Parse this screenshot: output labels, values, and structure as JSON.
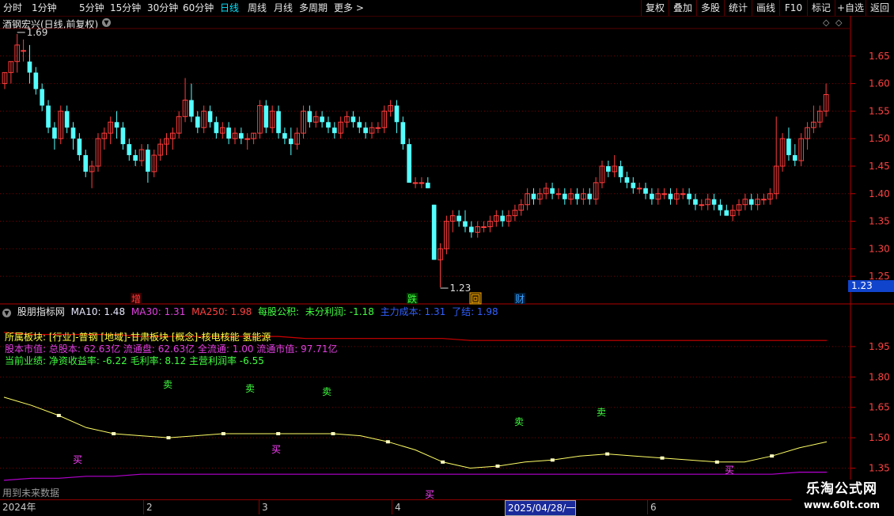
{
  "toolbar": {
    "periods": [
      "分时",
      "1分钟",
      "5分钟",
      "15分钟",
      "30分钟",
      "60分钟",
      "日线",
      "周线",
      "月线",
      "多周期",
      "更多 >"
    ],
    "active_period": "日线",
    "right_buttons": [
      "复权",
      "叠加",
      "多股",
      "统计",
      "画线",
      "F10",
      "标记",
      "+自选",
      "返回"
    ]
  },
  "stock_title": "酒钢宏兴(日线,前复权)",
  "diamond_icon": "◇",
  "price_axis": [
    "1.65",
    "1.60",
    "1.55",
    "1.50",
    "1.45",
    "1.40",
    "1.35",
    "1.30",
    "1.25"
  ],
  "price_high_label": "1.69",
  "price_low_label": "1.23",
  "current_price_label": "1.23",
  "event_tags": [
    "增",
    "跌",
    "回",
    "财"
  ],
  "indicator": {
    "name": "股朋指标网",
    "ma10": "MA10: 1.48",
    "ma30": "MA30: 1.31",
    "ma250": "MA250: 1.98",
    "eps_label": "每股公积:",
    "undist_label": "未分利润: -1.18",
    "cost_label": "主力成本: 1.31",
    "done_label": "了结: 1.98"
  },
  "info_lines": {
    "sector": "所属板块: [行业]-普钢 [地域]-甘肃板块 [概念]-核电核能 氢能源",
    "capital": "股本市值: 总股本: 62.63亿 流通盘: 62.63亿 全流通: 1.00 流通市值: 97.71亿",
    "perf": "当前业绩: 净资收益率: -6.22 毛利率: 8.12 主营利润率 -6.55"
  },
  "indicator_axis": [
    "1.95",
    "1.80",
    "1.65",
    "1.50",
    "1.35"
  ],
  "sell_label": "卖",
  "buy_label": "买",
  "future_data": "用到未来数据",
  "date_axis": [
    "2024年",
    "2",
    "3",
    "4",
    "2025/04/28/一",
    "6"
  ],
  "watermark": {
    "title": "乐淘公式网",
    "url": "www.60lt.com"
  },
  "colors": {
    "up": "#ff3c3c",
    "down": "#54ffff",
    "grid": "#7a0000",
    "ma_line": "#ffff66",
    "purple": "#b400d0"
  },
  "chart_data": {
    "type": "candlestick",
    "title": "酒钢宏兴(日线,前复权)",
    "y_range": [
      1.22,
      1.7
    ],
    "candles": [
      [
        1.6,
        1.62,
        1.59,
        1.62
      ],
      [
        1.62,
        1.64,
        1.6,
        1.64
      ],
      [
        1.64,
        1.69,
        1.62,
        1.67
      ],
      [
        1.66,
        1.68,
        1.64,
        1.66
      ],
      [
        1.64,
        1.67,
        1.6,
        1.62
      ],
      [
        1.62,
        1.63,
        1.58,
        1.59
      ],
      [
        1.59,
        1.6,
        1.55,
        1.56
      ],
      [
        1.56,
        1.57,
        1.51,
        1.52
      ],
      [
        1.52,
        1.53,
        1.48,
        1.5
      ],
      [
        1.5,
        1.56,
        1.49,
        1.55
      ],
      [
        1.55,
        1.56,
        1.51,
        1.52
      ],
      [
        1.52,
        1.53,
        1.48,
        1.5
      ],
      [
        1.5,
        1.51,
        1.46,
        1.47
      ],
      [
        1.47,
        1.48,
        1.43,
        1.44
      ],
      [
        1.44,
        1.46,
        1.41,
        1.45
      ],
      [
        1.45,
        1.51,
        1.44,
        1.5
      ],
      [
        1.5,
        1.52,
        1.48,
        1.51
      ],
      [
        1.51,
        1.54,
        1.49,
        1.53
      ],
      [
        1.53,
        1.55,
        1.5,
        1.52
      ],
      [
        1.52,
        1.53,
        1.48,
        1.49
      ],
      [
        1.49,
        1.5,
        1.46,
        1.47
      ],
      [
        1.47,
        1.48,
        1.45,
        1.46
      ],
      [
        1.46,
        1.49,
        1.45,
        1.48
      ],
      [
        1.48,
        1.49,
        1.42,
        1.44
      ],
      [
        1.44,
        1.48,
        1.43,
        1.47
      ],
      [
        1.47,
        1.5,
        1.46,
        1.49
      ],
      [
        1.49,
        1.51,
        1.47,
        1.5
      ],
      [
        1.5,
        1.52,
        1.48,
        1.51
      ],
      [
        1.51,
        1.55,
        1.5,
        1.54
      ],
      [
        1.54,
        1.61,
        1.53,
        1.57
      ],
      [
        1.57,
        1.6,
        1.53,
        1.54
      ],
      [
        1.54,
        1.55,
        1.51,
        1.52
      ],
      [
        1.52,
        1.56,
        1.51,
        1.55
      ],
      [
        1.55,
        1.56,
        1.52,
        1.53
      ],
      [
        1.53,
        1.54,
        1.5,
        1.51
      ],
      [
        1.51,
        1.53,
        1.5,
        1.52
      ],
      [
        1.52,
        1.53,
        1.49,
        1.5
      ],
      [
        1.5,
        1.52,
        1.49,
        1.51
      ],
      [
        1.51,
        1.52,
        1.49,
        1.5
      ],
      [
        1.5,
        1.51,
        1.48,
        1.5
      ],
      [
        1.5,
        1.51,
        1.49,
        1.51
      ],
      [
        1.51,
        1.57,
        1.5,
        1.56
      ],
      [
        1.56,
        1.57,
        1.51,
        1.52
      ],
      [
        1.52,
        1.56,
        1.51,
        1.55
      ],
      [
        1.55,
        1.56,
        1.5,
        1.51
      ],
      [
        1.51,
        1.52,
        1.49,
        1.5
      ],
      [
        1.5,
        1.52,
        1.47,
        1.49
      ],
      [
        1.49,
        1.52,
        1.48,
        1.51
      ],
      [
        1.51,
        1.56,
        1.5,
        1.55
      ],
      [
        1.55,
        1.56,
        1.52,
        1.53
      ],
      [
        1.53,
        1.55,
        1.52,
        1.54
      ],
      [
        1.54,
        1.55,
        1.52,
        1.53
      ],
      [
        1.53,
        1.54,
        1.51,
        1.52
      ],
      [
        1.52,
        1.53,
        1.5,
        1.51
      ],
      [
        1.51,
        1.54,
        1.5,
        1.53
      ],
      [
        1.53,
        1.55,
        1.52,
        1.54
      ],
      [
        1.54,
        1.55,
        1.52,
        1.53
      ],
      [
        1.53,
        1.54,
        1.51,
        1.52
      ],
      [
        1.52,
        1.53,
        1.5,
        1.51
      ],
      [
        1.51,
        1.53,
        1.5,
        1.52
      ],
      [
        1.52,
        1.53,
        1.51,
        1.52
      ],
      [
        1.52,
        1.56,
        1.51,
        1.55
      ],
      [
        1.55,
        1.57,
        1.54,
        1.56
      ],
      [
        1.56,
        1.57,
        1.51,
        1.53
      ],
      [
        1.53,
        1.54,
        1.48,
        1.49
      ],
      [
        1.49,
        1.5,
        1.42,
        1.42
      ],
      [
        1.42,
        1.43,
        1.41,
        1.42
      ],
      [
        1.42,
        1.43,
        1.41,
        1.42
      ],
      [
        1.42,
        1.43,
        1.41,
        1.41
      ],
      [
        1.38,
        1.38,
        1.28,
        1.28
      ],
      [
        1.28,
        1.31,
        1.23,
        1.3
      ],
      [
        1.3,
        1.36,
        1.29,
        1.35
      ],
      [
        1.35,
        1.37,
        1.33,
        1.36
      ],
      [
        1.36,
        1.37,
        1.34,
        1.35
      ],
      [
        1.35,
        1.37,
        1.33,
        1.34
      ],
      [
        1.34,
        1.35,
        1.32,
        1.33
      ],
      [
        1.33,
        1.35,
        1.32,
        1.34
      ],
      [
        1.34,
        1.35,
        1.33,
        1.34
      ],
      [
        1.34,
        1.36,
        1.33,
        1.35
      ],
      [
        1.35,
        1.37,
        1.34,
        1.36
      ],
      [
        1.36,
        1.37,
        1.34,
        1.35
      ],
      [
        1.35,
        1.37,
        1.34,
        1.36
      ],
      [
        1.36,
        1.38,
        1.35,
        1.37
      ],
      [
        1.37,
        1.39,
        1.36,
        1.38
      ],
      [
        1.38,
        1.41,
        1.37,
        1.4
      ],
      [
        1.4,
        1.41,
        1.38,
        1.39
      ],
      [
        1.39,
        1.41,
        1.38,
        1.4
      ],
      [
        1.4,
        1.42,
        1.39,
        1.41
      ],
      [
        1.41,
        1.42,
        1.39,
        1.4
      ],
      [
        1.4,
        1.41,
        1.39,
        1.4
      ],
      [
        1.4,
        1.41,
        1.38,
        1.39
      ],
      [
        1.39,
        1.41,
        1.38,
        1.4
      ],
      [
        1.4,
        1.41,
        1.38,
        1.39
      ],
      [
        1.39,
        1.41,
        1.38,
        1.4
      ],
      [
        1.4,
        1.41,
        1.38,
        1.39
      ],
      [
        1.39,
        1.43,
        1.38,
        1.42
      ],
      [
        1.42,
        1.46,
        1.41,
        1.45
      ],
      [
        1.45,
        1.46,
        1.43,
        1.44
      ],
      [
        1.44,
        1.47,
        1.43,
        1.45
      ],
      [
        1.45,
        1.46,
        1.42,
        1.43
      ],
      [
        1.43,
        1.44,
        1.41,
        1.42
      ],
      [
        1.42,
        1.43,
        1.4,
        1.41
      ],
      [
        1.41,
        1.42,
        1.4,
        1.41
      ],
      [
        1.41,
        1.42,
        1.39,
        1.4
      ],
      [
        1.4,
        1.41,
        1.38,
        1.39
      ],
      [
        1.39,
        1.41,
        1.38,
        1.4
      ],
      [
        1.4,
        1.41,
        1.39,
        1.4
      ],
      [
        1.4,
        1.41,
        1.38,
        1.39
      ],
      [
        1.39,
        1.41,
        1.38,
        1.4
      ],
      [
        1.4,
        1.41,
        1.39,
        1.4
      ],
      [
        1.4,
        1.41,
        1.38,
        1.39
      ],
      [
        1.39,
        1.4,
        1.37,
        1.38
      ],
      [
        1.38,
        1.39,
        1.37,
        1.38
      ],
      [
        1.38,
        1.4,
        1.37,
        1.39
      ],
      [
        1.39,
        1.4,
        1.37,
        1.38
      ],
      [
        1.38,
        1.39,
        1.36,
        1.37
      ],
      [
        1.37,
        1.38,
        1.36,
        1.36
      ],
      [
        1.36,
        1.38,
        1.35,
        1.37
      ],
      [
        1.37,
        1.39,
        1.36,
        1.38
      ],
      [
        1.38,
        1.4,
        1.37,
        1.39
      ],
      [
        1.39,
        1.4,
        1.37,
        1.38
      ],
      [
        1.38,
        1.4,
        1.37,
        1.39
      ],
      [
        1.39,
        1.4,
        1.38,
        1.39
      ],
      [
        1.39,
        1.41,
        1.38,
        1.4
      ],
      [
        1.4,
        1.54,
        1.39,
        1.45
      ],
      [
        1.45,
        1.51,
        1.44,
        1.5
      ],
      [
        1.5,
        1.52,
        1.46,
        1.47
      ],
      [
        1.47,
        1.49,
        1.45,
        1.46
      ],
      [
        1.46,
        1.51,
        1.45,
        1.5
      ],
      [
        1.5,
        1.53,
        1.48,
        1.52
      ],
      [
        1.52,
        1.56,
        1.51,
        1.53
      ],
      [
        1.53,
        1.56,
        1.52,
        1.55
      ],
      [
        1.55,
        1.6,
        1.54,
        1.58
      ]
    ],
    "indicator_series": {
      "ma_line": [
        1.7,
        1.66,
        1.61,
        1.55,
        1.52,
        1.51,
        1.5,
        1.51,
        1.52,
        1.52,
        1.52,
        1.52,
        1.52,
        1.51,
        1.48,
        1.44,
        1.38,
        1.35,
        1.36,
        1.38,
        1.39,
        1.41,
        1.42,
        1.41,
        1.4,
        1.39,
        1.38,
        1.38,
        1.41,
        1.45,
        1.48
      ],
      "purple_line": [
        1.29,
        1.3,
        1.3,
        1.31,
        1.31,
        1.32,
        1.32,
        1.32,
        1.32,
        1.32,
        1.32,
        1.32,
        1.32,
        1.32,
        1.32,
        1.32,
        1.32,
        1.32,
        1.32,
        1.32,
        1.32,
        1.32,
        1.32,
        1.32,
        1.32,
        1.32,
        1.32,
        1.32,
        1.32,
        1.33,
        1.33
      ],
      "red_line": [
        2.02,
        2.01,
        2.01,
        2.01,
        2.01,
        2.0,
        2.0,
        2.0,
        2.0,
        2.0,
        2.0,
        1.99,
        1.99,
        1.99,
        1.99,
        1.99,
        1.99,
        1.98,
        1.98,
        1.98,
        1.98,
        1.98,
        1.98,
        1.98,
        1.98,
        1.98,
        1.98,
        1.98,
        1.98,
        1.98,
        1.98
      ],
      "y_range": [
        1.27,
        2.02
      ]
    }
  }
}
